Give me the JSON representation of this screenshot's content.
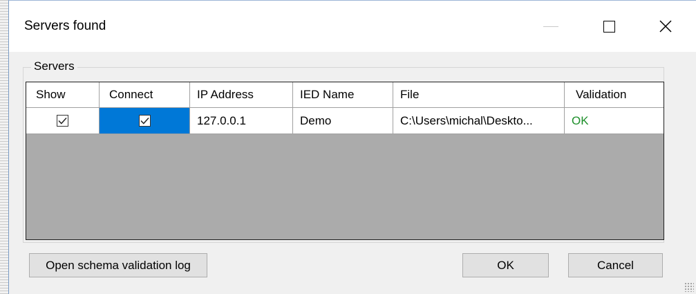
{
  "window": {
    "title": "Servers found",
    "minimize_icon": "minimize-icon",
    "maximize_icon": "maximize-icon",
    "close_icon": "close-icon"
  },
  "group": {
    "label": "Servers"
  },
  "grid": {
    "columns": [
      "Show",
      "Connect",
      "IP Address",
      "IED Name",
      "File",
      "Validation"
    ],
    "rows": [
      {
        "show": true,
        "connect": true,
        "ip": "127.0.0.1",
        "ied_name": "Demo",
        "file": "C:\\Users\\michal\\Deskto...",
        "validation": "OK"
      }
    ]
  },
  "buttons": {
    "open_log": "Open schema validation log",
    "ok": "OK",
    "cancel": "Cancel"
  },
  "colors": {
    "selection": "#0078d7",
    "validation_ok": "#1d8f2a",
    "grid_empty": "#ababab"
  }
}
